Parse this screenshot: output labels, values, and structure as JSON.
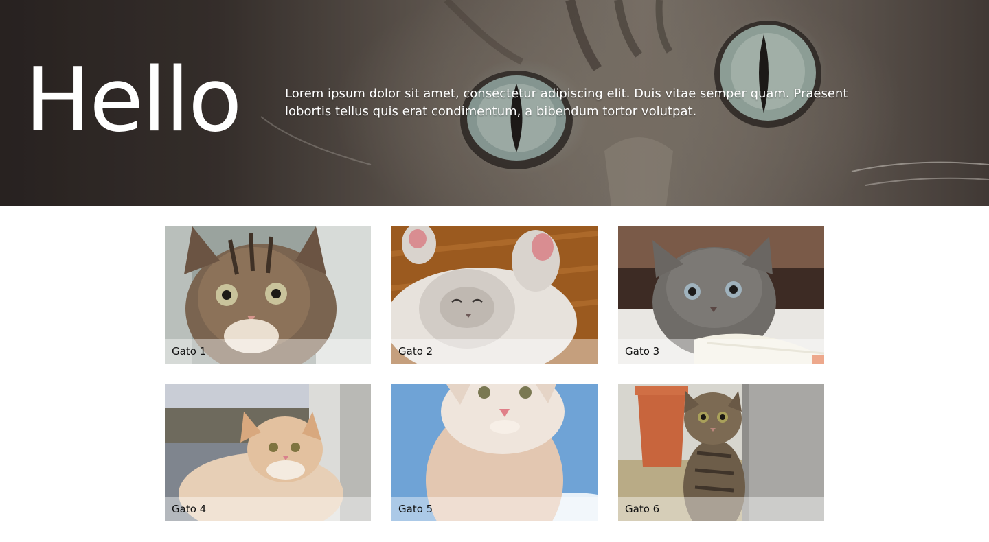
{
  "hero": {
    "title": "Hello",
    "text": "Lorem ipsum dolor sit amet, consectetur adipiscing elit. Duis vitae semper quam. Praesent lobortis tellus quis erat condimentum, a bibendum tortor volutpat."
  },
  "gallery": {
    "cards": [
      {
        "label": "Gato 1"
      },
      {
        "label": "Gato 2"
      },
      {
        "label": "Gato 3"
      },
      {
        "label": "Gato 4"
      },
      {
        "label": "Gato 5"
      },
      {
        "label": "Gato 6"
      }
    ]
  }
}
